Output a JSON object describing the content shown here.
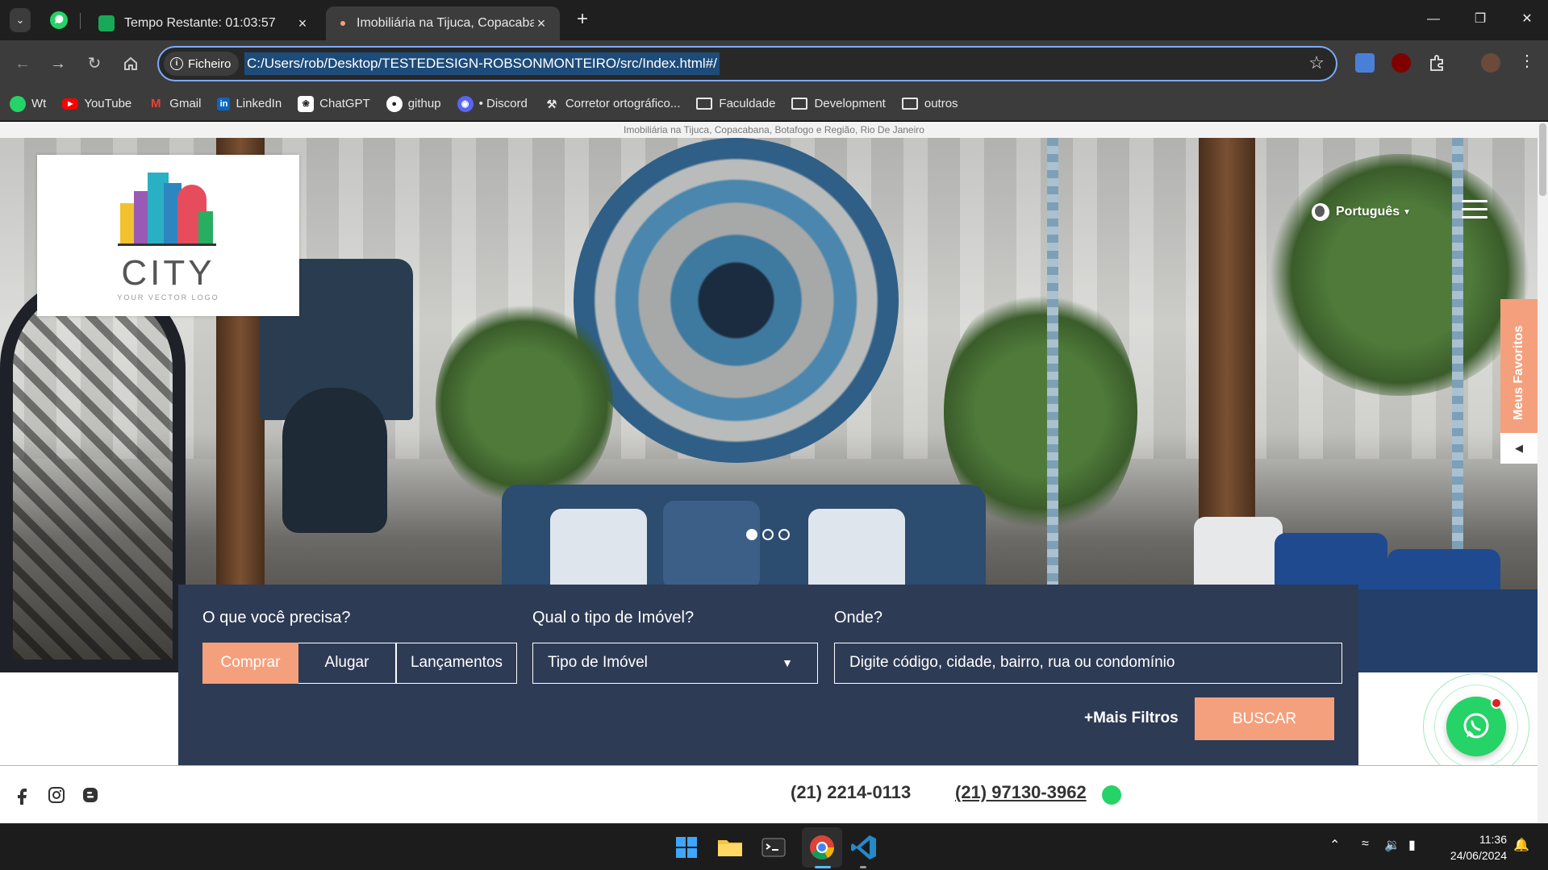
{
  "browser": {
    "tabs": [
      {
        "title": "Tempo Restante: 01:03:57"
      },
      {
        "title": "Imobiliária na Tijuca, Copacabar"
      }
    ],
    "address": {
      "security_chip": "Ficheiro",
      "url": "C:/Users/rob/Desktop/TESTEDESIGN-ROBSONMONTEIRO/src/Index.html#/"
    },
    "bookmarks": [
      {
        "label": "Wt",
        "icon": "whatsapp-icon",
        "color": "#25d366"
      },
      {
        "label": "YouTube",
        "icon": "youtube-icon",
        "color": "#ff0000"
      },
      {
        "label": "Gmail",
        "icon": "gmail-icon",
        "color": "#ea4335"
      },
      {
        "label": "LinkedIn",
        "icon": "linkedin-icon",
        "color": "#0a66c2"
      },
      {
        "label": "ChatGPT",
        "icon": "chatgpt-icon",
        "color": "#444444"
      },
      {
        "label": "githup",
        "icon": "github-icon",
        "color": "#222222"
      },
      {
        "label": "• Discord",
        "icon": "discord-icon",
        "color": "#5865f2"
      },
      {
        "label": "Corretor ortográfico...",
        "icon": "spellcheck-icon",
        "color": "#555555"
      },
      {
        "label": "Faculdade",
        "icon": "folder-icon"
      },
      {
        "label": "Development",
        "icon": "folder-icon"
      },
      {
        "label": "outros",
        "icon": "folder-icon"
      }
    ]
  },
  "page": {
    "top_text": "Imobiliária na Tijuca, Copacabana, Botafogo e Região, Rio De Janeiro",
    "logo": {
      "text": "CITY",
      "tagline": "YOUR VECTOR LOGO"
    },
    "language": "Português",
    "favorites_tab": "Meus Favoritos",
    "carousel": {
      "count": 3,
      "active": 1
    },
    "search": {
      "need_label": "O que você precisa?",
      "options": [
        "Comprar",
        "Alugar",
        "Lançamentos"
      ],
      "selected": "Comprar",
      "type_label": "Qual o tipo de Imóvel?",
      "type_value": "Tipo de Imóvel",
      "where_label": "Onde?",
      "where_placeholder": "Digite código, cidade, bairro, rua ou condomínio",
      "more_filters": "+Mais Filtros",
      "submit": "BUSCAR"
    },
    "footer": {
      "phone": "(21) 2214-0113",
      "whatsapp_phone": "(21) 97130-3962"
    },
    "colors": {
      "accent": "#f5a07c",
      "panel": "#2e3b55",
      "whatsapp": "#25d366"
    }
  },
  "taskbar": {
    "time": "11:36",
    "date": "24/06/2024"
  }
}
